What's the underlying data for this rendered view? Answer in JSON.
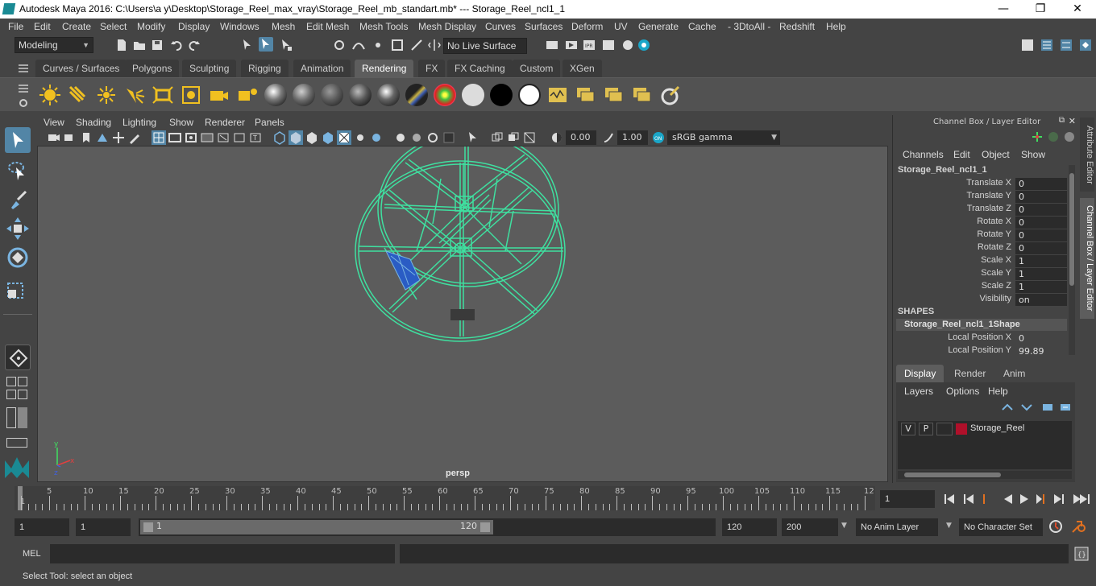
{
  "window": {
    "title": "Autodesk Maya 2016: C:\\Users\\a y\\Desktop\\Storage_Reel_max_vray\\Storage_Reel_mb_standart.mb*   ---   Storage_Reel_ncl1_1",
    "minimize": "—",
    "maximize": "❐",
    "close": "✕"
  },
  "menubar": [
    "File",
    "Edit",
    "Create",
    "Select",
    "Modify",
    "Display",
    "Windows",
    "Mesh",
    "Edit Mesh",
    "Mesh Tools",
    "Mesh Display",
    "Curves",
    "Surfaces",
    "Deform",
    "UV",
    "Generate",
    "Cache",
    "- 3DtoAll -",
    "Redshift",
    "Help"
  ],
  "status_line": {
    "mode": "Modeling",
    "live_surface": "No Live Surface"
  },
  "shelf_tabs": [
    "Curves / Surfaces",
    "Polygons",
    "Sculpting",
    "Rigging",
    "Animation",
    "Rendering",
    "FX",
    "FX Caching",
    "Custom",
    "XGen"
  ],
  "active_shelf_tab": "Rendering",
  "viewport": {
    "menu": [
      "View",
      "Shading",
      "Lighting",
      "Show",
      "Renderer",
      "Panels"
    ],
    "exposure": "0.00",
    "gamma": "1.00",
    "color_space": "sRGB gamma",
    "camera_label": "persp"
  },
  "channel_box": {
    "header": "Channel Box / Layer Editor",
    "menu": [
      "Channels",
      "Edit",
      "Object",
      "Show"
    ],
    "object_name": "Storage_Reel_ncl1_1",
    "attributes": [
      {
        "name": "Translate X",
        "value": "0"
      },
      {
        "name": "Translate Y",
        "value": "0"
      },
      {
        "name": "Translate Z",
        "value": "0"
      },
      {
        "name": "Rotate X",
        "value": "0"
      },
      {
        "name": "Rotate Y",
        "value": "0"
      },
      {
        "name": "Rotate Z",
        "value": "0"
      },
      {
        "name": "Scale X",
        "value": "1"
      },
      {
        "name": "Scale Y",
        "value": "1"
      },
      {
        "name": "Scale Z",
        "value": "1"
      },
      {
        "name": "Visibility",
        "value": "on"
      }
    ],
    "shapes_label": "SHAPES",
    "shape_name": "Storage_Reel_ncl1_1Shape",
    "shape_attributes": [
      {
        "name": "Local Position X",
        "value": "0"
      },
      {
        "name": "Local Position Y",
        "value": "99.89"
      }
    ],
    "side_tabs": [
      "Attribute Editor",
      "Channel Box / Layer Editor"
    ]
  },
  "layer_editor": {
    "tabs": [
      "Display",
      "Render",
      "Anim"
    ],
    "active_tab": "Display",
    "menu": [
      "Layers",
      "Options",
      "Help"
    ],
    "layers": [
      {
        "visible": "V",
        "playback": "P",
        "color": "#b0102a",
        "name": "Storage_Reel"
      }
    ]
  },
  "time_slider": {
    "ticks": [
      "1",
      "5",
      "10",
      "15",
      "20",
      "25",
      "30",
      "35",
      "40",
      "45",
      "50",
      "55",
      "60",
      "65",
      "70",
      "75",
      "80",
      "85",
      "90",
      "95",
      "100",
      "105",
      "110",
      "115",
      "12"
    ],
    "current_frame": "1"
  },
  "range_slider": {
    "start": "1",
    "inner_start": "1",
    "slider_start": "1",
    "slider_end": "120",
    "end": "120",
    "outer_end": "200",
    "anim_layer": "No Anim Layer",
    "character_set": "No Character Set"
  },
  "command_line": {
    "label": "MEL"
  },
  "help_line": "Select Tool: select an object",
  "colors": {
    "accent": "#5285a6",
    "wireframe": "#3fe0a0",
    "selected_face": "#2a5cc4"
  }
}
